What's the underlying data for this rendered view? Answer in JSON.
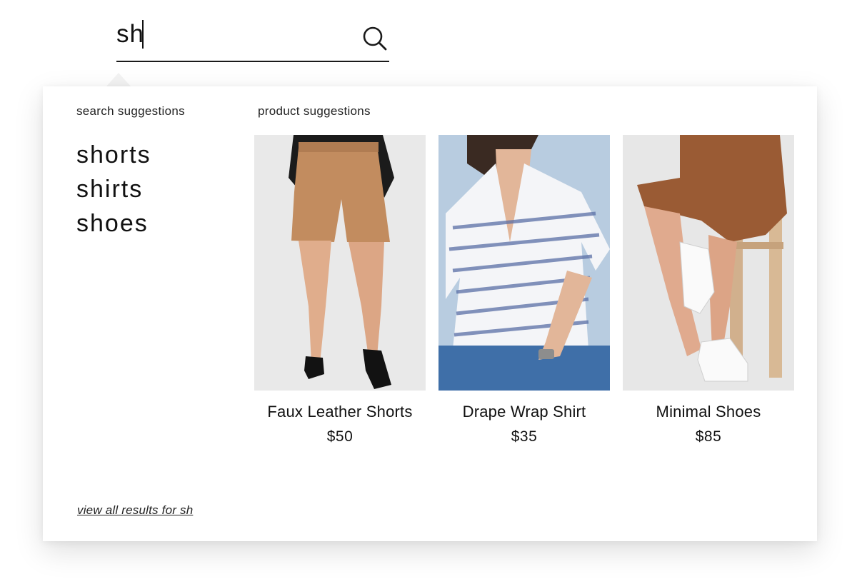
{
  "search": {
    "value": "sh",
    "placeholder": ""
  },
  "dropdown": {
    "search_suggestions_label": "search suggestions",
    "product_suggestions_label": "product suggestions",
    "suggestions": [
      "shorts",
      "shirts",
      "shoes"
    ],
    "products": [
      {
        "name": "Faux Leather Shorts",
        "price": "$50",
        "image": "model-in-tan-shorts-photo"
      },
      {
        "name": "Drape Wrap Shirt",
        "price": "$35",
        "image": "model-in-striped-shirt-photo"
      },
      {
        "name": "Minimal Shoes",
        "price": "$85",
        "image": "model-in-white-sneakers-photo"
      }
    ],
    "view_all_label": "view all results for sh"
  },
  "icons": {
    "search": "search-icon"
  },
  "colors": {
    "text": "#111111",
    "underline": "#1a1a1a",
    "panel_bg": "#ffffff"
  }
}
